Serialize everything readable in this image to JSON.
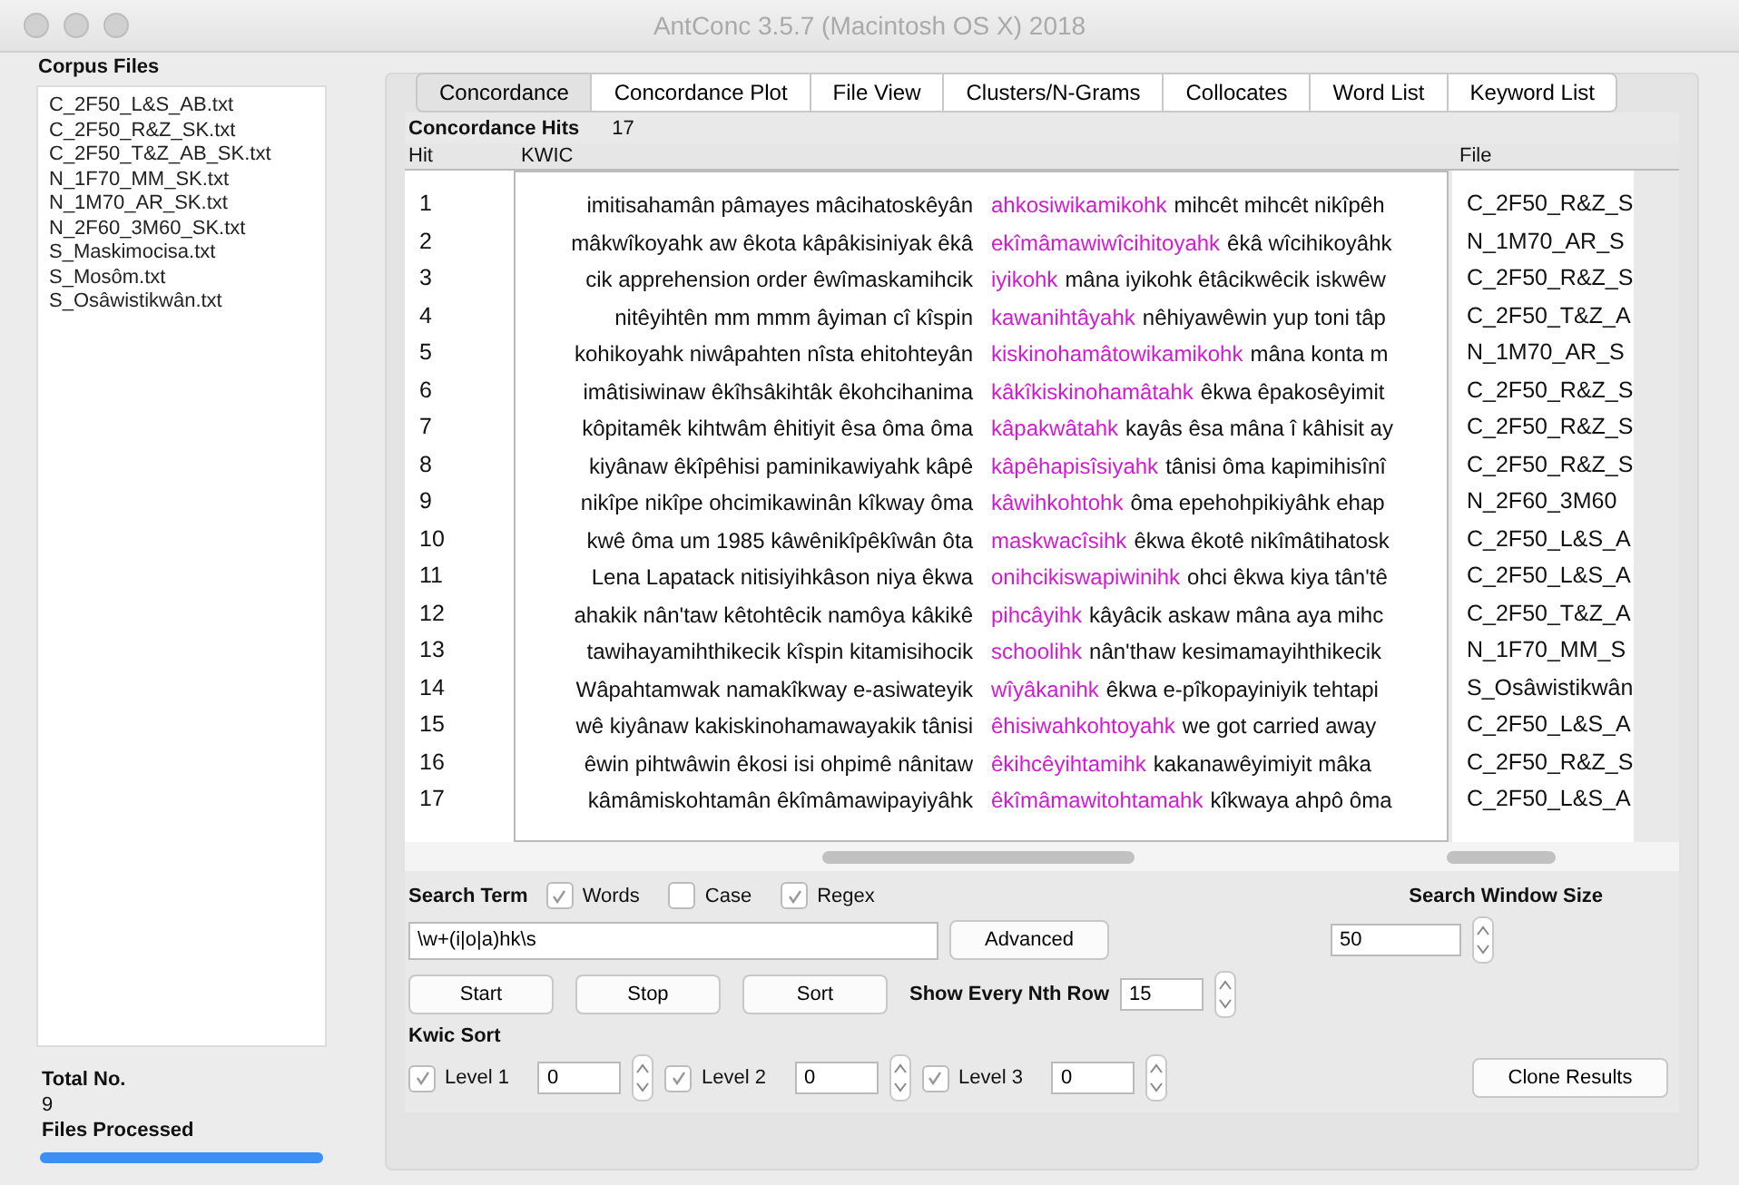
{
  "window": {
    "title": "AntConc 3.5.7 (Macintosh OS X) 2018"
  },
  "corpus": {
    "heading": "Corpus Files",
    "files": [
      "C_2F50_L&S_AB.txt",
      "C_2F50_R&Z_SK.txt",
      "C_2F50_T&Z_AB_SK.txt",
      "N_1F70_MM_SK.txt",
      "N_1M70_AR_SK.txt",
      "N_2F60_3M60_SK.txt",
      "S_Maskimocisa.txt",
      "S_Mosôm.txt",
      "S_Osâwistikwân.txt"
    ],
    "total_label": "Total No.",
    "total": "9",
    "processed_label": "Files Processed",
    "progress": {
      "level": 1
    }
  },
  "tabs": [
    {
      "label": "Concordance",
      "selected": true
    },
    {
      "label": "Concordance Plot",
      "selected": false
    },
    {
      "label": "File View",
      "selected": false
    },
    {
      "label": "Clusters/N-Grams",
      "selected": false
    },
    {
      "label": "Collocates",
      "selected": false
    },
    {
      "label": "Word List",
      "selected": false
    },
    {
      "label": "Keyword List",
      "selected": false
    }
  ],
  "hits": {
    "label": "Concordance Hits",
    "count": "17"
  },
  "table": {
    "columns": [
      "Hit",
      "KWIC",
      "File"
    ],
    "rows": [
      {
        "hit": "1",
        "left": "imitisahamân pâmayes mâcihatoskêyân",
        "keyword": "ahkosiwikamikohk",
        "right": "mihcêt mihcêt nikîpêh",
        "file": "C_2F50_R&Z_S"
      },
      {
        "hit": "2",
        "left": "mâkwîkoyahk aw êkota kâpâkisiniyak êkâ",
        "keyword": "ekîmâmawiwîcihitoyahk",
        "right": "êkâ wîcihikoyâhk",
        "file": "N_1M70_AR_S"
      },
      {
        "hit": "3",
        "left": "cik apprehension order êwîmaskamihcik",
        "keyword": "iyikohk",
        "right": "mâna iyikohk êtâcikwêcik iskwêw",
        "file": "C_2F50_R&Z_S"
      },
      {
        "hit": "4",
        "left": "nitêyihtên mm mmm âyiman cî kîspin",
        "keyword": "kawanihtâyahk",
        "right": "nêhiyawêwin yup toni tâp",
        "file": "C_2F50_T&Z_A"
      },
      {
        "hit": "5",
        "left": "kohikoyahk niwâpahten nîsta ehitohteyân",
        "keyword": "kiskinohamâtowikamikohk",
        "right": "mâna konta m",
        "file": "N_1M70_AR_S"
      },
      {
        "hit": "6",
        "left": "imâtisiwinaw êkîhsâkihtâk êkohcihanima",
        "keyword": "kâkîkiskinohamâtahk",
        "right": "êkwa êpakosêyimit",
        "file": "C_2F50_R&Z_S"
      },
      {
        "hit": "7",
        "left": "kôpitamêk kihtwâm êhitiyit êsa ôma ôma",
        "keyword": "kâpakwâtahk",
        "right": "kayâs êsa mâna î kâhisit ay",
        "file": "C_2F50_R&Z_S"
      },
      {
        "hit": "8",
        "left": "kiyânaw êkîpêhisi paminikawiyahk kâpê",
        "keyword": "kâpêhapisîsiyahk",
        "right": "tânisi ôma kapimihisînî",
        "file": "C_2F50_R&Z_S"
      },
      {
        "hit": "9",
        "left": "nikîpe nikîpe ohcimikawinân kîkway ôma",
        "keyword": "kâwihkohtohk",
        "right": "ôma epehohpikiyâhk ehap",
        "file": "N_2F60_3M60"
      },
      {
        "hit": "10",
        "left": "kwê ôma um 1985 kâwênikîpêkîwân ôta",
        "keyword": "maskwacîsihk",
        "right": "êkwa êkotê nikîmâtihatosk",
        "file": "C_2F50_L&S_A"
      },
      {
        "hit": "11",
        "left": "Lena Lapatack nitisiyihkâson niya êkwa",
        "keyword": "onihcikiswapiwinihk",
        "right": "ohci êkwa kiya tân'tê",
        "file": "C_2F50_L&S_A"
      },
      {
        "hit": "12",
        "left": "ahakik nân'taw kêtohtêcik namôya kâkikê",
        "keyword": "pihcâyihk",
        "right": "kâyâcik askaw mâna aya mihc",
        "file": "C_2F50_T&Z_A"
      },
      {
        "hit": "13",
        "left": "tawihayamihthikecik kîspin kitamisihocik",
        "keyword": "schoolihk",
        "right": "nân'thaw kesimamayihthikecik",
        "file": "N_1F70_MM_S"
      },
      {
        "hit": "14",
        "left": "Wâpahtamwak namakîkway e-asiwateyik",
        "keyword": "wîyâkanihk",
        "right": "êkwa e-pîkopayiniyik tehtapi",
        "file": "S_Osâwistikwân"
      },
      {
        "hit": "15",
        "left": "wê kiyânaw kakiskinohamawayakik tânisi",
        "keyword": "êhisiwahkohtoyahk",
        "right": "we got carried away",
        "file": "C_2F50_L&S_A"
      },
      {
        "hit": "16",
        "left": "êwin pihtwâwin êkosi isi ohpimê nânitaw",
        "keyword": "êkihcêyihtamihk",
        "right": "kakanawêyimiyit mâka",
        "file": "C_2F50_R&Z_S"
      },
      {
        "hit": "17",
        "left": "kâmâmiskohtamân êkîmâmawipayiyâhk",
        "keyword": "êkîmâmawitohtamahk",
        "right": "kîkwaya ahpô ôma",
        "file": "C_2F50_L&S_A"
      }
    ]
  },
  "search": {
    "label": "Search Term",
    "options": [
      {
        "label": "Words",
        "checked": true
      },
      {
        "label": "Case",
        "checked": false
      },
      {
        "label": "Regex",
        "checked": true
      }
    ],
    "value": "\\w+(i|o|a)hk\\s",
    "advanced": "Advanced",
    "window_label": "Search Window Size",
    "window_size": "50"
  },
  "actions": [
    "Start",
    "Stop",
    "Sort"
  ],
  "nth_row": {
    "label": "Show Every Nth Row",
    "value": "15"
  },
  "kwic_sort": {
    "label": "Kwic Sort",
    "levels": [
      {
        "label": "Level 1",
        "checked": true,
        "value": "0"
      },
      {
        "label": "Level 2",
        "checked": true,
        "value": "0"
      },
      {
        "label": "Level 3",
        "checked": true,
        "value": "0"
      }
    ]
  },
  "clone": "Clone Results"
}
